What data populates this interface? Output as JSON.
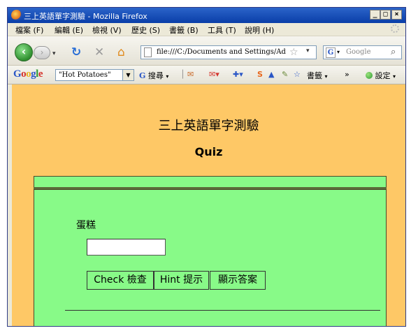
{
  "window": {
    "title": "三上英語單字測驗 - Mozilla Firefox",
    "minimize": "_",
    "maximize": "□",
    "close": "×"
  },
  "menu": {
    "items": [
      "檔案 (F)",
      "編輯 (E)",
      "檢視 (V)",
      "歷史 (S)",
      "書籤 (B)",
      "工具 (T)",
      "說明 (H)"
    ]
  },
  "nav": {
    "url": "file:///C:/Documents and Settings/Administ",
    "search_placeholder": "Google"
  },
  "google_toolbar": {
    "logo_letters": [
      {
        "ch": "G",
        "color": "#2a56c6"
      },
      {
        "ch": "o",
        "color": "#d4332c"
      },
      {
        "ch": "o",
        "color": "#e8b21c"
      },
      {
        "ch": "g",
        "color": "#2a56c6"
      },
      {
        "ch": "l",
        "color": "#2f9a36"
      },
      {
        "ch": "e",
        "color": "#d4332c"
      }
    ],
    "search_value": "\"Hot Potatoes\"",
    "search_label": "搜尋",
    "bookmarks_label": "書籤",
    "chevron": "»",
    "settings_label": "設定"
  },
  "page": {
    "heading": "三上英語單字測驗",
    "quiz_title": "Quiz",
    "question_word": "蛋糕",
    "answer_value": "",
    "check_button": "Check 檢查",
    "hint_button": "Hint 提示",
    "show_answer_button": "顯示答案"
  },
  "colors": {
    "page_background": "#fec866",
    "panel_background": "#88fa88"
  }
}
